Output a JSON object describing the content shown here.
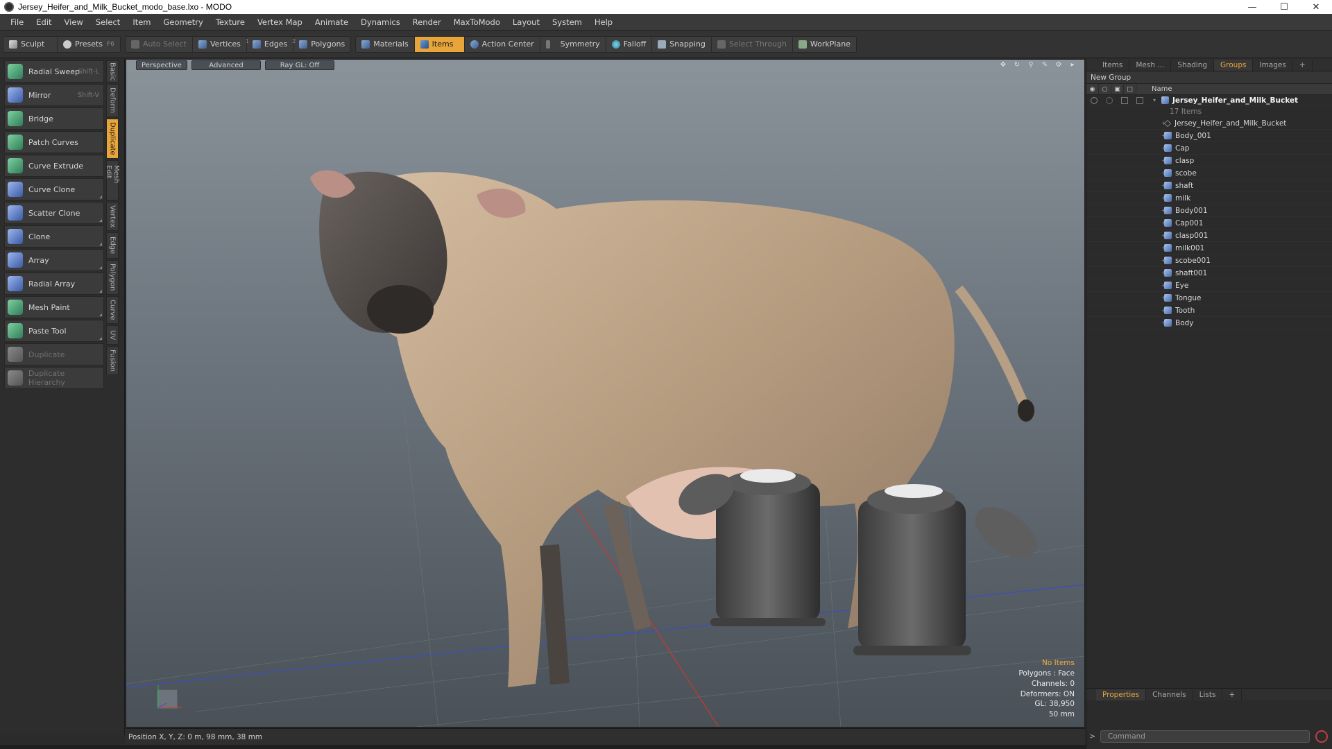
{
  "window": {
    "title": "Jersey_Heifer_and_Milk_Bucket_modo_base.lxo - MODO"
  },
  "menu": [
    "File",
    "Edit",
    "View",
    "Select",
    "Item",
    "Geometry",
    "Texture",
    "Vertex Map",
    "Animate",
    "Dynamics",
    "Render",
    "MaxToModo",
    "Layout",
    "System",
    "Help"
  ],
  "toolbar": {
    "sculpt": "Sculpt",
    "presets": "Presets",
    "presets_key": "F6",
    "auto_select": "Auto Select",
    "vertices": "Vertices",
    "vertices_num": "1",
    "edges": "Edges",
    "edges_num": "2",
    "polygons": "Polygons",
    "materials": "Materials",
    "items": "Items",
    "action_center": "Action Center",
    "symmetry": "Symmetry",
    "falloff": "Falloff",
    "snapping": "Snapping",
    "select_through": "Select Through",
    "workplane": "WorkPlane"
  },
  "tools": [
    {
      "label": "Radial Sweep",
      "shortcut": "Shift-L"
    },
    {
      "label": "Mirror",
      "shortcut": "Shift-V"
    },
    {
      "label": "Bridge",
      "shortcut": ""
    },
    {
      "label": "Patch Curves",
      "shortcut": ""
    },
    {
      "label": "Curve Extrude",
      "shortcut": ""
    },
    {
      "label": "Curve Clone",
      "shortcut": ""
    },
    {
      "label": "Scatter Clone",
      "shortcut": ""
    },
    {
      "label": "Clone",
      "shortcut": ""
    },
    {
      "label": "Array",
      "shortcut": ""
    },
    {
      "label": "Radial Array",
      "shortcut": ""
    },
    {
      "label": "Mesh Paint",
      "shortcut": ""
    },
    {
      "label": "Paste Tool",
      "shortcut": ""
    },
    {
      "label": "Duplicate",
      "shortcut": ""
    },
    {
      "label": "Duplicate Hierarchy",
      "shortcut": ""
    }
  ],
  "side_tabs": [
    "Basic",
    "Deform",
    "Duplicate",
    "Mesh Edit",
    "Vertex",
    "Edge",
    "Polygon",
    "Curve",
    "UV",
    "Fusion"
  ],
  "viewport": {
    "tabs": [
      "Perspective",
      "Advanced",
      "Ray GL: Off"
    ],
    "info": {
      "no_items": "No Items",
      "polygons": "Polygons : Face",
      "channels": "Channels: 0",
      "deformers": "Deformers: ON",
      "gl": "GL: 38,950",
      "focal": "50 mm"
    }
  },
  "status": {
    "position": "Position X, Y, Z:  0 m, 98 mm, 38 mm"
  },
  "right_panel": {
    "tabs": [
      "Items",
      "Mesh ...",
      "Shading",
      "Groups",
      "Images"
    ],
    "active_tab": "Groups",
    "new_group": "New Group",
    "name_header": "Name",
    "root": {
      "name": "Jersey_Heifer_and_Milk_Bucket",
      "count": "17 Items"
    },
    "items": [
      "Jersey_Heifer_and_Milk_Bucket",
      "Body_001",
      "Cap",
      "clasp",
      "scobe",
      "shaft",
      "milk",
      "Body001",
      "Cap001",
      "clasp001",
      "milk001",
      "scobe001",
      "shaft001",
      "Eye",
      "Tongue",
      "Tooth",
      "Body"
    ],
    "bottom_tabs": [
      "Properties",
      "Channels",
      "Lists"
    ],
    "command_placeholder": "Command"
  }
}
